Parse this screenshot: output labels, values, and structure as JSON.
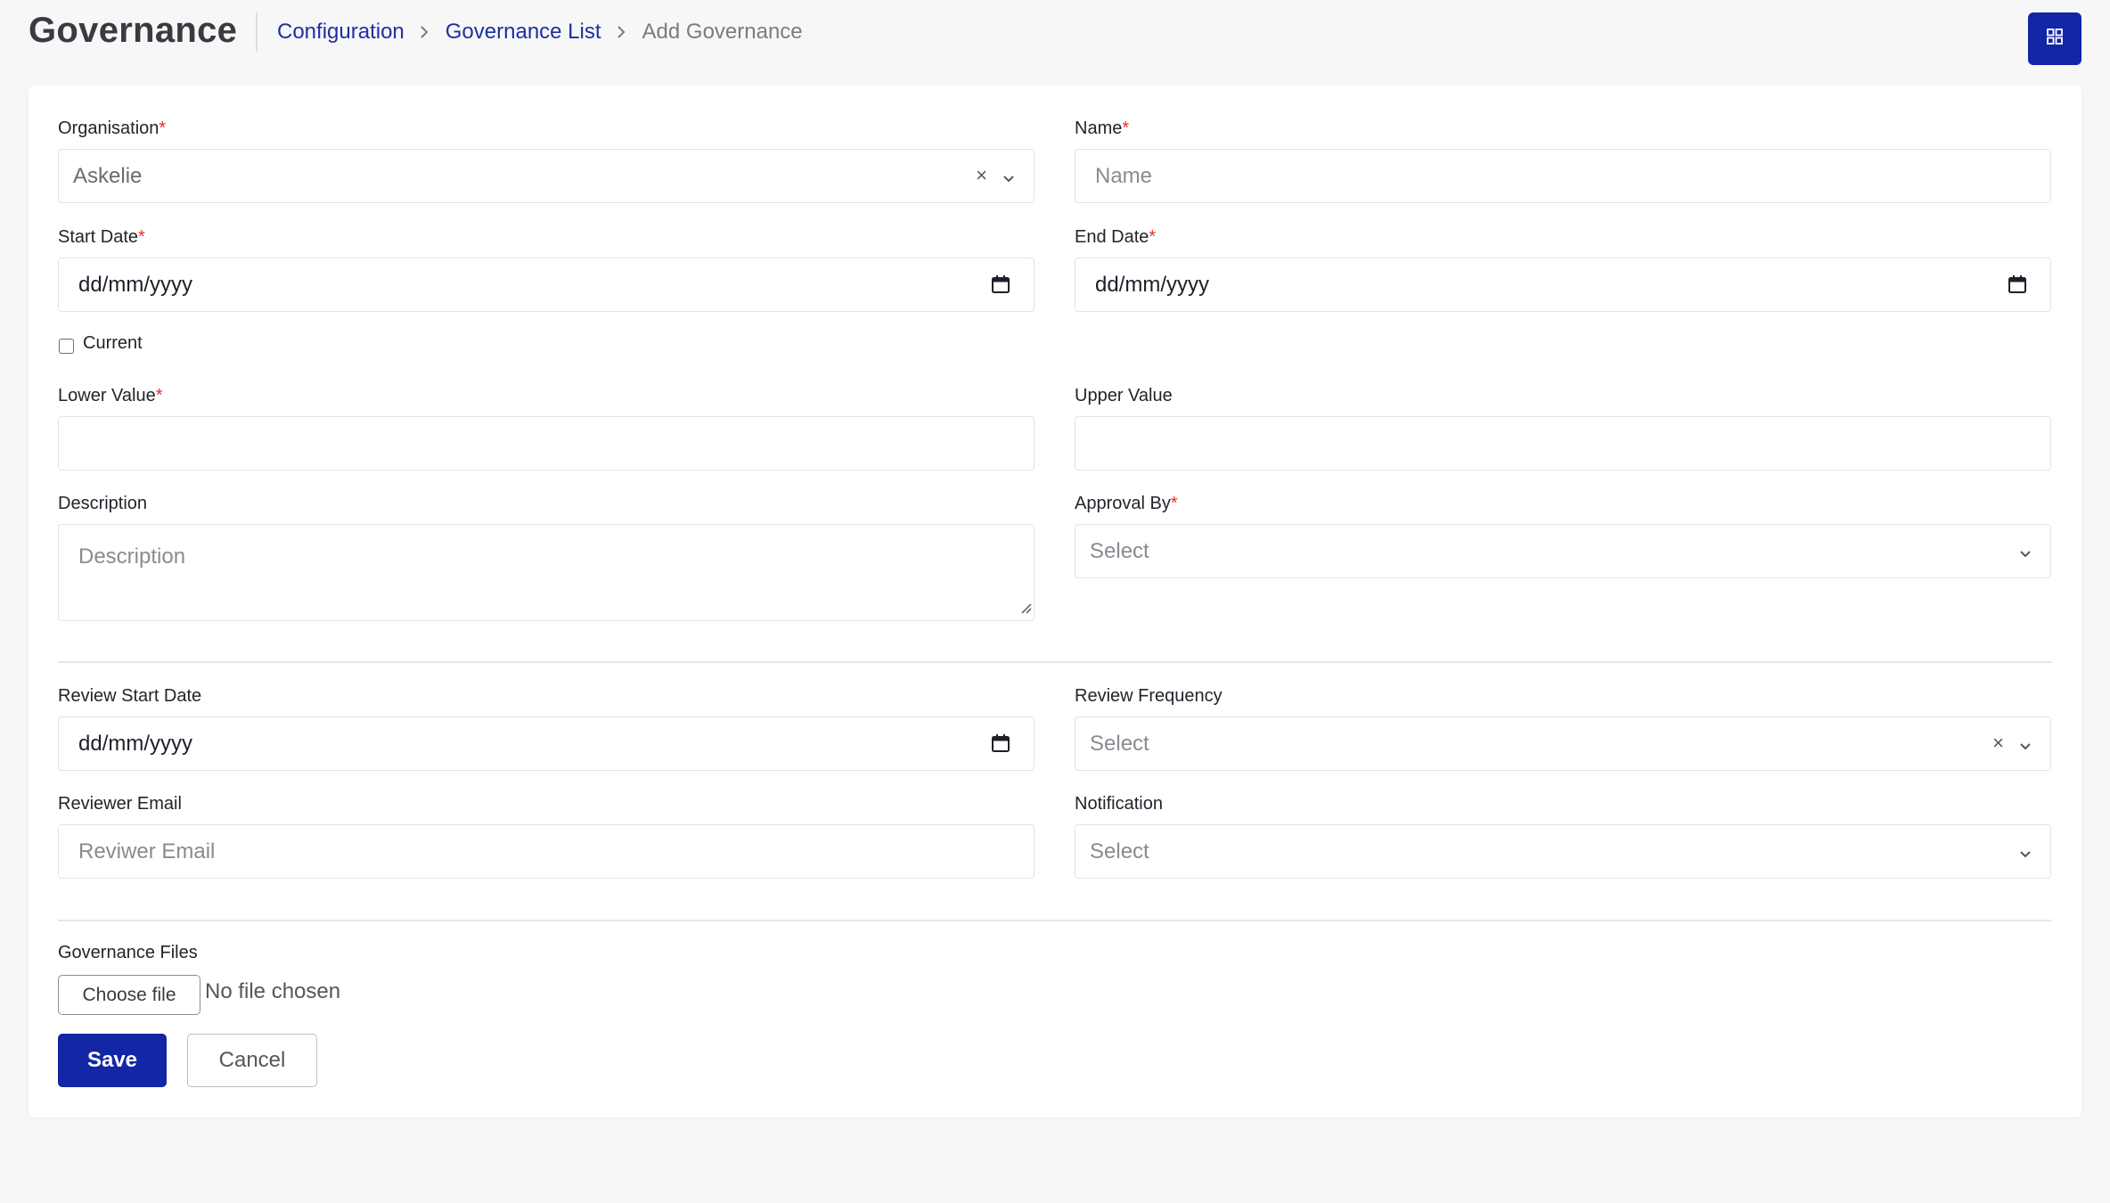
{
  "header": {
    "title": "Governance",
    "breadcrumb": [
      "Configuration",
      "Governance List",
      "Add Governance"
    ]
  },
  "form": {
    "organisation": {
      "label": "Organisation",
      "required_mark": "*",
      "value": "Askelie"
    },
    "name": {
      "label": "Name",
      "required_mark": "*",
      "placeholder": "Name"
    },
    "start_date": {
      "label": "Start Date",
      "required_mark": "*",
      "value": "dd/mm/yyyy"
    },
    "end_date": {
      "label": "End Date",
      "required_mark": "*",
      "value": "dd/mm/yyyy"
    },
    "current": {
      "label": "Current",
      "checked": false
    },
    "lower_value": {
      "label": "Lower Value",
      "required_mark": "*",
      "value": ""
    },
    "upper_value": {
      "label": "Upper Value",
      "value": ""
    },
    "description": {
      "label": "Description",
      "placeholder": "Description"
    },
    "approval_by": {
      "label": "Approval By",
      "required_mark": "*",
      "placeholder": "Select"
    },
    "review_start_date": {
      "label": "Review Start Date",
      "value": "dd/mm/yyyy"
    },
    "review_frequency": {
      "label": "Review Frequency",
      "placeholder": "Select"
    },
    "reviewer_email": {
      "label": "Reviewer Email",
      "placeholder": "Reviwer Email"
    },
    "notification": {
      "label": "Notification",
      "placeholder": "Select"
    },
    "governance_files": {
      "label": "Governance Files",
      "button_label": "Choose file",
      "status": "No file chosen"
    }
  },
  "actions": {
    "save_label": "Save",
    "cancel_label": "Cancel"
  },
  "colors": {
    "primary": "#1226a6",
    "link": "#1e2fa0",
    "required": "#e03131"
  },
  "icons": {
    "grid": "grid-icon",
    "calendar": "calendar-icon",
    "clear": "close-icon",
    "dropdown": "chevron-down-icon",
    "breadcrumb_separator": "chevron-right-icon"
  }
}
